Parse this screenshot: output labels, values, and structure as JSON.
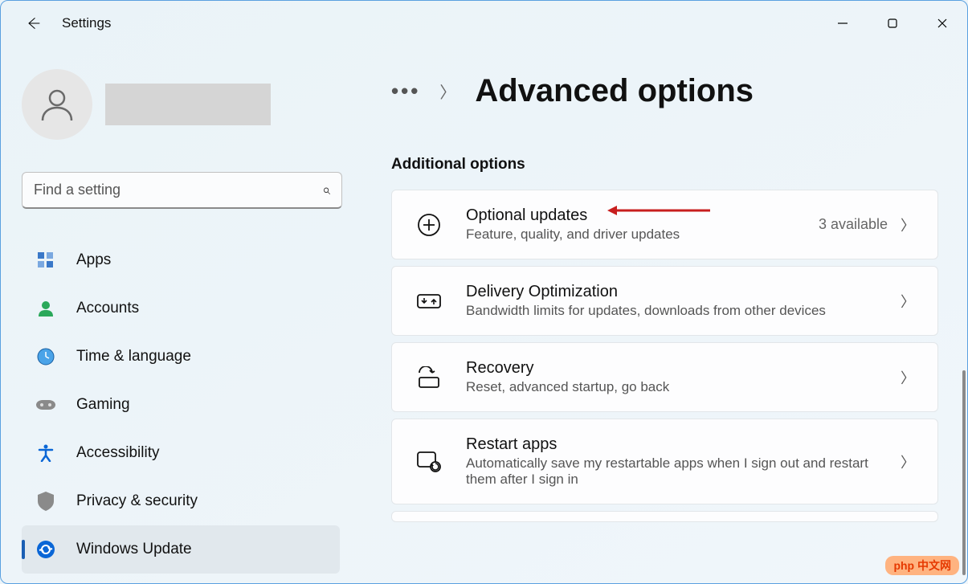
{
  "app_title": "Settings",
  "search": {
    "placeholder": "Find a setting"
  },
  "sidebar": {
    "items": [
      {
        "label": "Apps"
      },
      {
        "label": "Accounts"
      },
      {
        "label": "Time & language"
      },
      {
        "label": "Gaming"
      },
      {
        "label": "Accessibility"
      },
      {
        "label": "Privacy & security"
      },
      {
        "label": "Windows Update"
      }
    ]
  },
  "breadcrumb": {
    "title": "Advanced options"
  },
  "section_label": "Additional options",
  "cards": [
    {
      "title": "Optional updates",
      "subtitle": "Feature, quality, and driver updates",
      "status": "3 available"
    },
    {
      "title": "Delivery Optimization",
      "subtitle": "Bandwidth limits for updates, downloads from other devices",
      "status": ""
    },
    {
      "title": "Recovery",
      "subtitle": "Reset, advanced startup, go back",
      "status": ""
    },
    {
      "title": "Restart apps",
      "subtitle": "Automatically save my restartable apps when I sign out and restart them after I sign in",
      "status": ""
    }
  ],
  "watermark": "php 中文网"
}
